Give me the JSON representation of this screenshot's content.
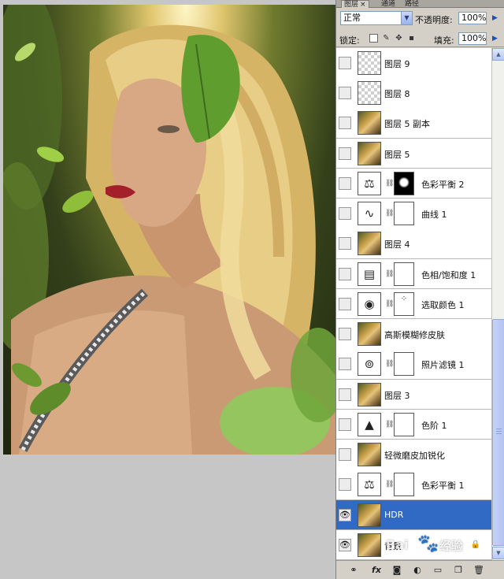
{
  "panel": {
    "tabs": [
      {
        "label": "图层",
        "active": true
      },
      {
        "label": "通道",
        "active": false
      },
      {
        "label": "路径",
        "active": false
      }
    ],
    "tab_close": "×",
    "blend_mode": "正常",
    "opacity_label": "不透明度:",
    "opacity_value": "100%",
    "lock_label": "锁定:",
    "fill_label": "填充:",
    "fill_value": "100%"
  },
  "layers": [
    {
      "name": "图层 9",
      "visible": false,
      "thumb": "transparent",
      "mask": null
    },
    {
      "name": "图层 8",
      "visible": false,
      "thumb": "transparent",
      "mask": null
    },
    {
      "name": "图层 5 副本",
      "visible": false,
      "thumb": "photo",
      "mask": null
    },
    {
      "name": "图层 5",
      "visible": false,
      "thumb": "photo",
      "mask": null
    },
    {
      "name": "色彩平衡 2",
      "visible": false,
      "thumb": "color-balance-icon",
      "mask": "dark"
    },
    {
      "name": "曲线 1",
      "visible": false,
      "thumb": "curves-icon",
      "mask": "white"
    },
    {
      "name": "图层 4",
      "visible": false,
      "thumb": "photo",
      "mask": null
    },
    {
      "name": "色相/饱和度 1",
      "visible": false,
      "thumb": "hue-saturation-icon",
      "mask": "white"
    },
    {
      "name": "选取颜色 1",
      "visible": false,
      "thumb": "selective-color-icon",
      "mask": "speck"
    },
    {
      "name": "高斯模糊修皮肤",
      "visible": false,
      "thumb": "photo",
      "mask": null
    },
    {
      "name": "照片滤镜 1",
      "visible": false,
      "thumb": "photo-filter-icon",
      "mask": "white"
    },
    {
      "name": "图层 3",
      "visible": false,
      "thumb": "photo",
      "mask": null
    },
    {
      "name": "色阶 1",
      "visible": false,
      "thumb": "levels-icon",
      "mask": "white"
    },
    {
      "name": "轻微磨皮加锐化",
      "visible": false,
      "thumb": "photo",
      "mask": null
    },
    {
      "name": "色彩平衡 1",
      "visible": false,
      "thumb": "color-balance-icon",
      "mask": "white"
    },
    {
      "name": "HDR",
      "visible": true,
      "thumb": "photo",
      "mask": null,
      "selected": true
    },
    {
      "name": "背景",
      "visible": true,
      "thumb": "photo",
      "mask": null,
      "locked": true
    }
  ],
  "watermark": {
    "brand": "Bai",
    "text": "经验",
    "paw": "🐾"
  },
  "colors": {
    "selection": "#316ac5",
    "panel_bg": "#d4d0c8",
    "canvas_bg": "#c6c6c6"
  }
}
